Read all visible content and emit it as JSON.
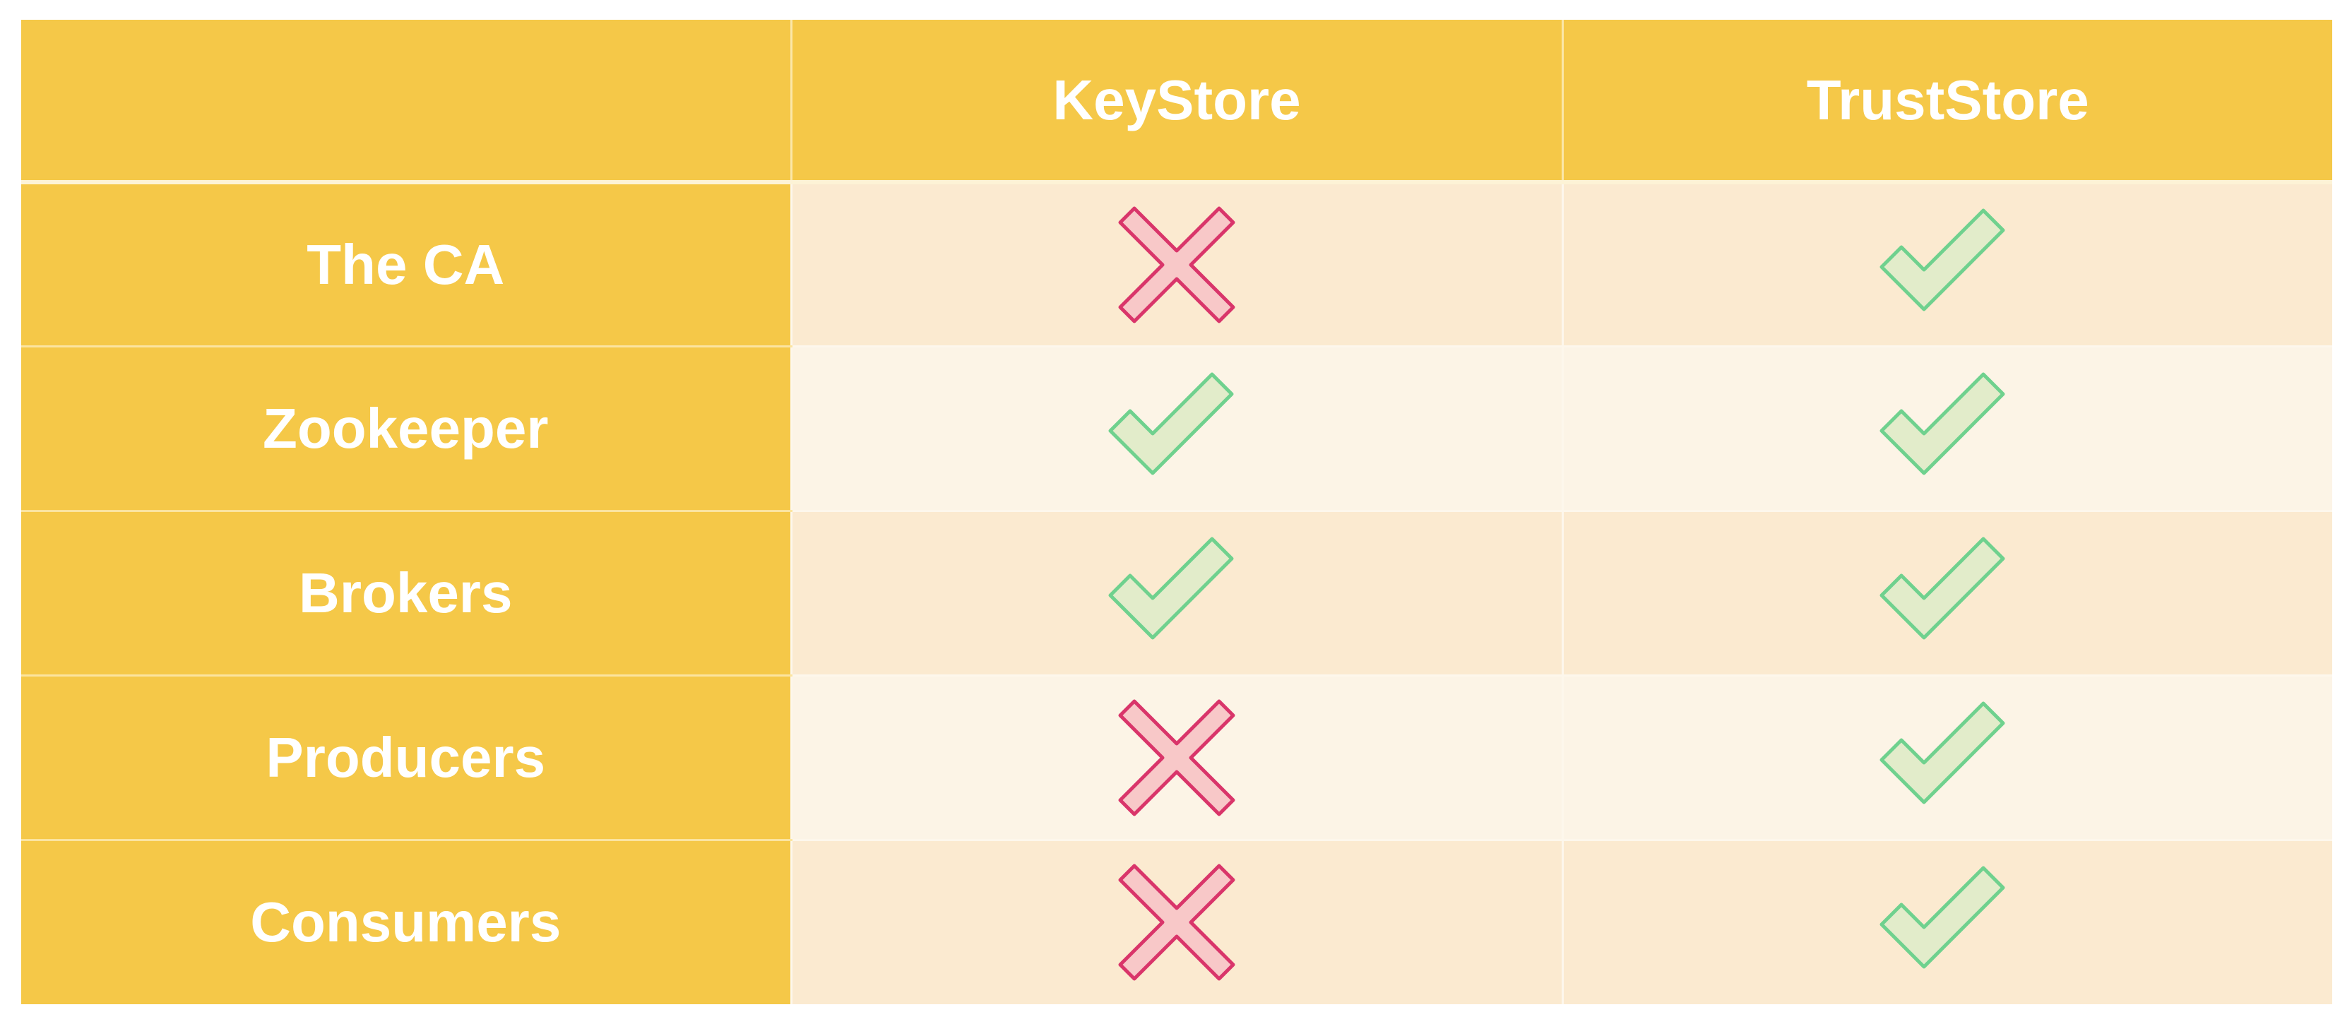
{
  "table": {
    "columns": [
      "",
      "KeyStore",
      "TrustStore"
    ],
    "rows": [
      {
        "label": "The CA",
        "keystore": "cross",
        "truststore": "check"
      },
      {
        "label": "Zookeeper",
        "keystore": "check",
        "truststore": "check"
      },
      {
        "label": "Brokers",
        "keystore": "check",
        "truststore": "check"
      },
      {
        "label": "Producers",
        "keystore": "cross",
        "truststore": "check"
      },
      {
        "label": "Consumers",
        "keystore": "cross",
        "truststore": "check"
      }
    ]
  },
  "icons": {
    "check": "check-icon",
    "cross": "cross-icon"
  },
  "colors": {
    "header_bg": "#f5c848",
    "label_bg": "#f5c848",
    "row_tint_a": "#fbead0",
    "row_tint_b": "#fcf4e6",
    "check_stroke": "#6fd18e",
    "check_fill": "#e2ecca",
    "cross_stroke": "#d9356a",
    "cross_fill": "#f8c8c8"
  }
}
